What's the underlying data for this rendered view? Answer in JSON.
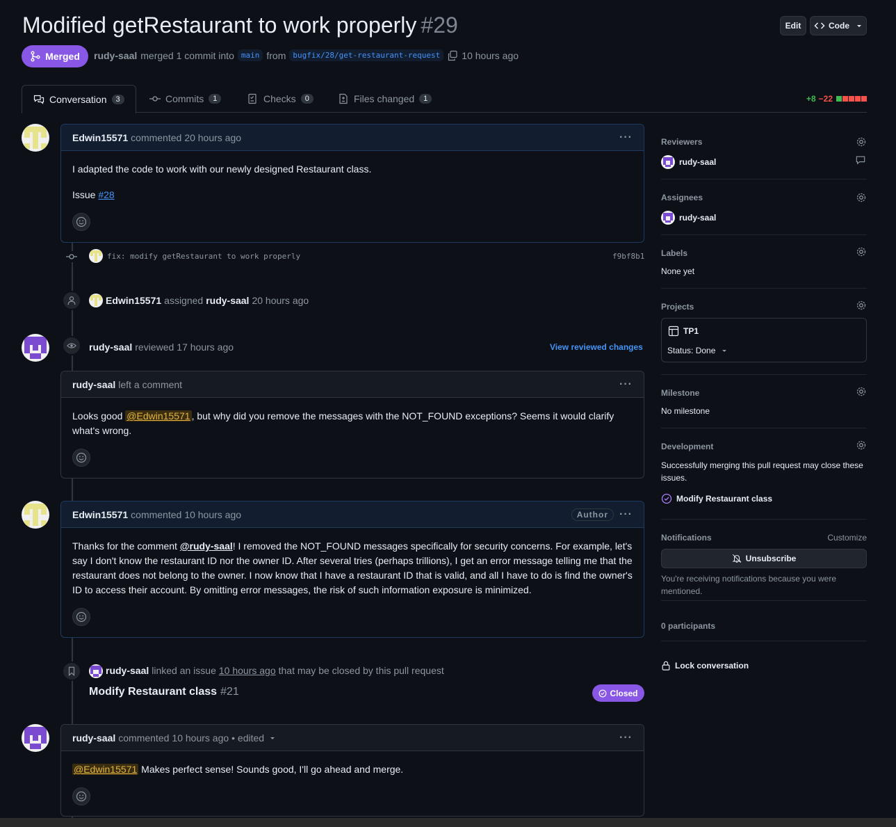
{
  "header": {
    "title": "Modified getRestaurant to work properly",
    "number": "#29",
    "edit_label": "Edit",
    "code_label": "Code",
    "state_label": "Merged",
    "author": "rudy-saal",
    "merged_text": "merged 1 commit into",
    "base_branch": "main",
    "from_text": "from",
    "head_branch": "bugfix/28/get-restaurant-request",
    "time": "10 hours ago"
  },
  "tabs": [
    {
      "label": "Conversation",
      "count": "3"
    },
    {
      "label": "Commits",
      "count": "1"
    },
    {
      "label": "Checks",
      "count": "0"
    },
    {
      "label": "Files changed",
      "count": "1"
    }
  ],
  "diffstat": {
    "additions": "+8",
    "deletions": "−22"
  },
  "timeline": {
    "comment1": {
      "author": "Edwin15571",
      "action": "commented",
      "time": "20 hours ago",
      "body_line1": "I adapted the code to work with our newly designed Restaurant class.",
      "issue_prefix": "Issue",
      "issue_link": "#28"
    },
    "commit": {
      "message": "fix: modify getRestaurant to work properly",
      "sha": "f9bf8b1"
    },
    "assign_event": {
      "actor": "Edwin15571",
      "action": "assigned",
      "target": "rudy-saal",
      "time": "20 hours ago"
    },
    "review": {
      "author": "rudy-saal",
      "action": "reviewed",
      "time": "17 hours ago",
      "view_changes": "View reviewed changes",
      "inner_author": "rudy-saal",
      "inner_action": "left a comment",
      "body_pre": "Looks good ",
      "mention": "@Edwin15571",
      "body_post": ", but why did you remove the messages with the NOT_FOUND exceptions? Seems it would clarify what's wrong."
    },
    "comment2": {
      "author": "Edwin15571",
      "action": "commented",
      "time": "10 hours ago",
      "badge": "Author",
      "body_pre": "Thanks for the comment ",
      "mention": "@rudy-saal",
      "body_post": "! I removed the NOT_FOUND messages specifically for security concerns. For example, let's say I don't know the restaurant ID nor the owner ID. After several tries (perhaps trillions), I get an error message telling me that the restaurant does not belong to the owner. I now know that I have a restaurant ID that is valid, and all I have to do is find the owner's ID to access their account. By omitting error messages, the risk of such information exposure is minimized."
    },
    "link_event": {
      "actor": "rudy-saal",
      "pre": "linked an issue",
      "time": "10 hours ago",
      "post": "that may be closed by this pull request",
      "issue_title": "Modify Restaurant class",
      "issue_number": "#21",
      "issue_state": "Closed"
    },
    "comment3": {
      "author": "rudy-saal",
      "action": "commented",
      "time": "10 hours ago",
      "edited": "• edited",
      "mention": "@Edwin15571",
      "body_post": " Makes perfect sense! Sounds good, I'll go ahead and merge."
    }
  },
  "sidebar": {
    "reviewers_label": "Reviewers",
    "reviewer": "rudy-saal",
    "assignees_label": "Assignees",
    "assignee": "rudy-saal",
    "labels_label": "Labels",
    "labels_value": "None yet",
    "projects_label": "Projects",
    "project_name": "TP1",
    "project_status": "Status: Done",
    "milestone_label": "Milestone",
    "milestone_value": "No milestone",
    "development_label": "Development",
    "development_text": "Successfully merging this pull request may close these issues.",
    "development_issue": "Modify Restaurant class",
    "notifications_label": "Notifications",
    "customize_label": "Customize",
    "unsubscribe_label": "Unsubscribe",
    "notifications_reason": "You're receiving notifications because you were mentioned.",
    "participants": "0 participants",
    "lock_label": "Lock conversation"
  },
  "colors": {
    "merged_purple": "#8957e5",
    "link_blue": "#4493f8",
    "additions_green": "#3fb950",
    "deletions_red": "#f85149"
  }
}
